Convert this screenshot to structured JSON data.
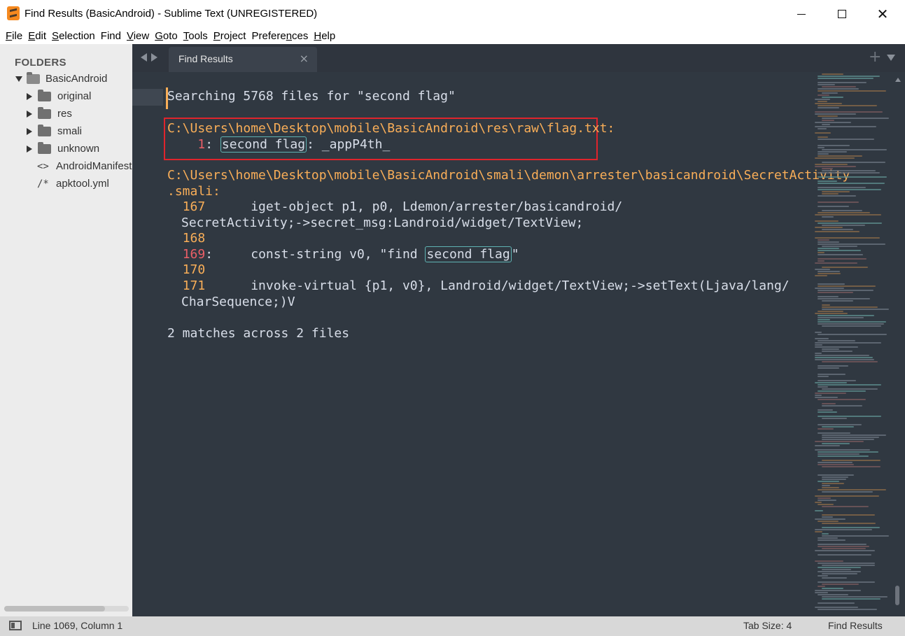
{
  "window": {
    "title": "Find Results (BasicAndroid) - Sublime Text (UNREGISTERED)"
  },
  "menu": {
    "items": [
      {
        "label": "File",
        "ul": "F",
        "rest": "ile"
      },
      {
        "label": "Edit",
        "ul": "E",
        "rest": "dit"
      },
      {
        "label": "Selection",
        "ul": "S",
        "rest": "election"
      },
      {
        "label": "Find",
        "ul": "F",
        "rest": "ind",
        "pre": ""
      },
      {
        "label": "View",
        "ul": "V",
        "rest": "iew"
      },
      {
        "label": "Goto",
        "ul": "G",
        "rest": "oto"
      },
      {
        "label": "Tools",
        "ul": "T",
        "rest": "ools"
      },
      {
        "label": "Project",
        "ul": "P",
        "rest": "roject"
      },
      {
        "label": "Preferences",
        "ul": "n",
        "pre": "Prefere",
        "rest": "ces"
      },
      {
        "label": "Help",
        "ul": "H",
        "rest": "elp"
      }
    ]
  },
  "sidebar": {
    "heading": "FOLDERS",
    "root": "BasicAndroid",
    "folders": [
      "original",
      "res",
      "smali",
      "unknown"
    ],
    "files": [
      {
        "glyph": "<>",
        "name": "AndroidManifest.xml"
      },
      {
        "glyph": "/*",
        "name": "apktool.yml"
      }
    ]
  },
  "tabs": {
    "active": "Find Results",
    "close_glyph": "×",
    "new_tab_glyph": "+"
  },
  "editor": {
    "search_header": "Searching 5768 files for \"second flag\"",
    "result1": {
      "path": "C:\\Users\\home\\Desktop\\mobile\\BasicAndroid\\res\\raw\\flag.txt:",
      "line_no": "1",
      "sep": ": ",
      "match": "second flag",
      "after": ": _appP4th_"
    },
    "result2": {
      "path_line1": "C:\\Users\\home\\Desktop\\mobile\\BasicAndroid\\smali\\demon\\arrester\\basicandroid\\SecretActivity",
      "path_line2": ".smali:",
      "lines": [
        {
          "no": "167",
          "text": "      iget-object p1, p0, Ldemon/arrester/basicandroid/",
          "wrap": "SecretActivity;->secret_msg:Landroid/widget/TextView;"
        },
        {
          "no": "168",
          "text": ""
        },
        {
          "no": "169",
          "colon": ":",
          "before": "     const-string v0, \"find ",
          "match": "second flag",
          "after": "\""
        },
        {
          "no": "170",
          "text": ""
        },
        {
          "no": "171",
          "text": "      invoke-virtual {p1, v0}, Landroid/widget/TextView;->setText(Ljava/lang/",
          "wrap": "CharSequence;)V"
        }
      ]
    },
    "summary": "2 matches across 2 files"
  },
  "statusbar": {
    "position": "Line 1069, Column 1",
    "tab_size": "Tab Size: 4",
    "syntax": "Find Results"
  },
  "colors": {
    "editor_bg": "#303841",
    "path_orange": "#f9ae58",
    "match_line_red": "#ec5f67",
    "match_outline": "#5fb3b3",
    "annotation_red": "#e0242c"
  }
}
